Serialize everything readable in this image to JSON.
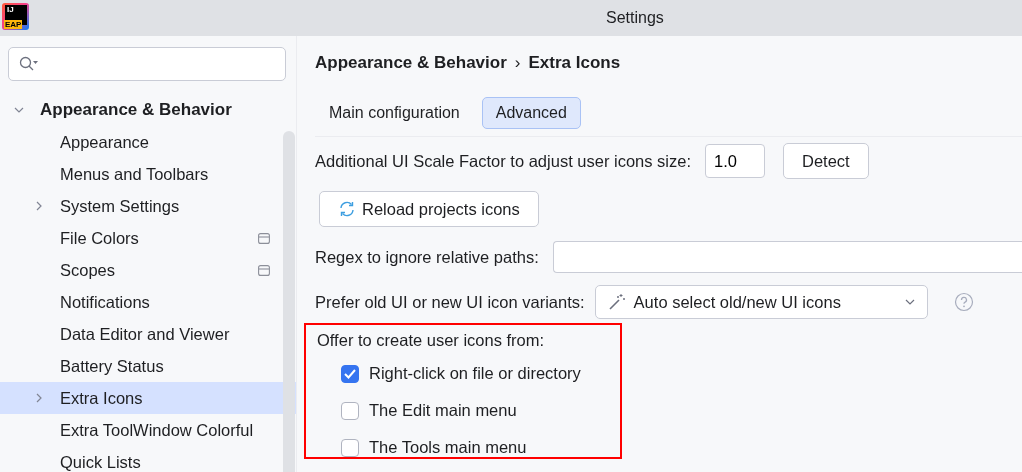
{
  "window": {
    "title": "Settings",
    "logo": {
      "top": "IJ",
      "badge": "EAP"
    }
  },
  "sidebar": {
    "items": [
      {
        "label": "Appearance & Behavior",
        "expanded": true,
        "selected": false,
        "children": [
          {
            "label": "Appearance",
            "selected": false
          },
          {
            "label": "Menus and Toolbars",
            "selected": false
          },
          {
            "label": "System Settings",
            "expanded": false,
            "selected": false
          },
          {
            "label": "File Colors",
            "selected": false,
            "project_level": true
          },
          {
            "label": "Scopes",
            "selected": false,
            "project_level": true
          },
          {
            "label": "Notifications",
            "selected": false
          },
          {
            "label": "Data Editor and Viewer",
            "selected": false
          },
          {
            "label": "Battery Status",
            "selected": false
          },
          {
            "label": "Extra Icons",
            "expanded": false,
            "selected": true
          },
          {
            "label": "Extra ToolWindow Colorful",
            "selected": false
          },
          {
            "label": "Quick Lists",
            "selected": false
          }
        ]
      }
    ]
  },
  "breadcrumb": {
    "parent": "Appearance & Behavior",
    "separator": "›",
    "current": "Extra Icons"
  },
  "tabs": [
    {
      "label": "Main configuration",
      "selected": false
    },
    {
      "label": "Advanced",
      "selected": true
    }
  ],
  "scale": {
    "label": "Additional UI Scale Factor to adjust user icons size:",
    "value": "1.0",
    "button": "Detect"
  },
  "reload_button": "Reload projects icons",
  "regex": {
    "label": "Regex to ignore relative paths:"
  },
  "variants": {
    "label": "Prefer old UI or new UI icon variants:",
    "value": "Auto select old/new UI icons"
  },
  "offer": {
    "label": "Offer to create user icons from:",
    "highlighted": true,
    "options": [
      {
        "label": "Right-click on file or directory",
        "checked": true
      },
      {
        "label": "The Edit main menu",
        "checked": false
      },
      {
        "label": "The Tools main menu",
        "checked": false
      }
    ]
  }
}
